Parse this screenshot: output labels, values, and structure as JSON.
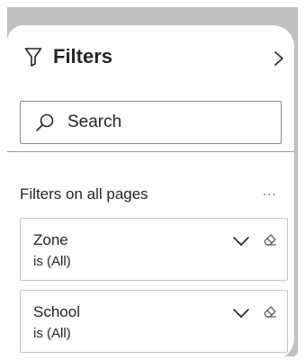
{
  "pane": {
    "title": "Filters",
    "icon": "filter-icon",
    "collapse_icon": "chevron-right-icon"
  },
  "search": {
    "placeholder": "Search",
    "value": ""
  },
  "section": {
    "title": "Filters on all pages",
    "more": "..."
  },
  "filters": [
    {
      "name": "Zone",
      "state": "is (All)"
    },
    {
      "name": "School",
      "state": "is (All)"
    }
  ],
  "colors": {
    "text": "#252423",
    "border": "#8a8886",
    "card_border": "#c8c6c4",
    "backdrop": "#bfbfbf"
  }
}
